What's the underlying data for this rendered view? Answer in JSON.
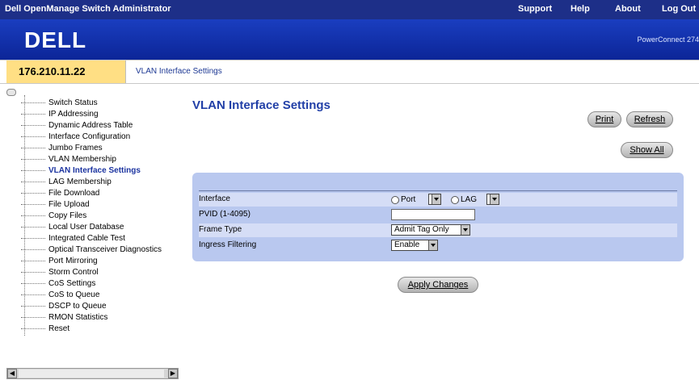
{
  "header": {
    "app_title": "Dell OpenManage Switch Administrator",
    "links": [
      "Support",
      "Help",
      "About",
      "Log Out"
    ]
  },
  "brand": {
    "logo_text": "DELL",
    "product": "PowerConnect 274"
  },
  "address": {
    "ip": "176.210.11.22",
    "breadcrumb": "VLAN Interface Settings"
  },
  "tree": {
    "items": [
      "Switch Status",
      "IP Addressing",
      "Dynamic Address Table",
      "Interface Configuration",
      "Jumbo Frames",
      "VLAN Membership",
      "VLAN Interface Settings",
      "LAG Membership",
      "File Download",
      "File Upload",
      "Copy Files",
      "Local User Database",
      "Integrated Cable Test",
      "Optical Transceiver Diagnostics",
      "Port Mirroring",
      "Storm Control",
      "CoS Settings",
      "CoS to Queue",
      "DSCP to Queue",
      "RMON Statistics",
      "Reset"
    ],
    "active": "VLAN Interface Settings"
  },
  "page": {
    "title": "VLAN Interface Settings",
    "buttons": {
      "print": "Print",
      "refresh": "Refresh",
      "show_all": "Show All",
      "apply": "Apply Changes"
    }
  },
  "form": {
    "interface_label": "Interface",
    "port_label": "Port",
    "lag_label": "LAG",
    "port_value": "",
    "lag_value": "",
    "pvid_label": "PVID (1-4095)",
    "pvid_value": "",
    "frame_type_label": "Frame Type",
    "frame_type_value": "Admit Tag Only",
    "ingress_label": "Ingress Filtering",
    "ingress_value": "Enable"
  },
  "colors": {
    "header_bg": "#1d2f88",
    "banner_bg": "#0c2597",
    "ip_box": "#ffdf84",
    "title_blue": "#213fa7",
    "form_bg": "#b9c8ef",
    "row_alt": "#d5ddf6"
  }
}
